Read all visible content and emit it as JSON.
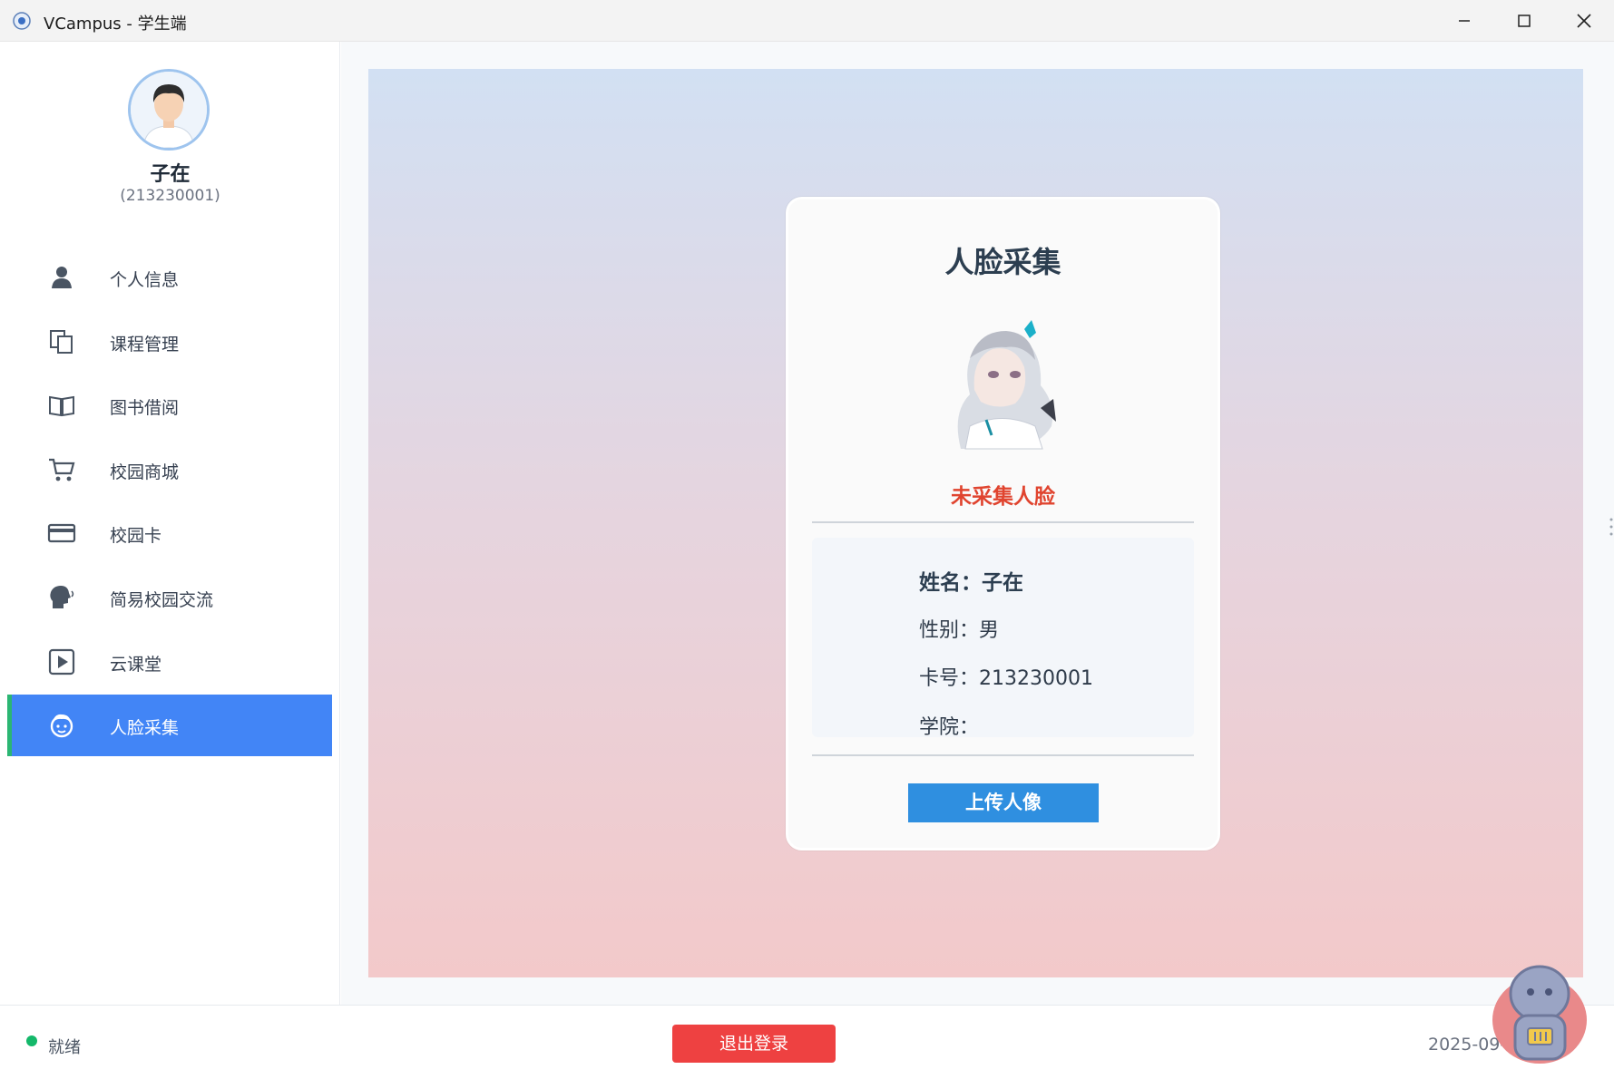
{
  "window": {
    "title": "VCampus - 学生端",
    "minimize_icon": "minimize-icon",
    "maximize_icon": "maximize-icon",
    "close_icon": "close-icon"
  },
  "sidebar": {
    "user": {
      "name": "子在",
      "id": "(213230001)",
      "avatar_icon": "user-avatar"
    },
    "items": [
      {
        "label": "个人信息",
        "icon": "person-icon",
        "active": false
      },
      {
        "label": "课程管理",
        "icon": "copy-icon",
        "active": false
      },
      {
        "label": "图书借阅",
        "icon": "open-book-icon",
        "active": false
      },
      {
        "label": "校园商城",
        "icon": "shopping-cart-icon",
        "active": false
      },
      {
        "label": "校园卡",
        "icon": "card-icon",
        "active": false
      },
      {
        "label": "简易校园交流",
        "icon": "chat-head-icon",
        "active": false
      },
      {
        "label": "云课堂",
        "icon": "play-icon",
        "active": false
      },
      {
        "label": "人脸采集",
        "icon": "face-icon",
        "active": true
      }
    ]
  },
  "face_card": {
    "title": "人脸采集",
    "status": "未采集人脸",
    "name_label": "姓名：子在",
    "gender_label": "性别：男",
    "card_label": "卡号：213230001",
    "college_label": "学院：",
    "upload_button": "上传人像"
  },
  "footer": {
    "status": "就绪",
    "logout_button": "退出登录",
    "datetime": "2025-09-2"
  },
  "colors": {
    "accent": "#4285f6",
    "active_bar": "#2bb673",
    "status_red": "#e0442f",
    "upload_blue": "#2f8fe0",
    "logout_red": "#ee4141",
    "ready_green": "#14b86a"
  }
}
